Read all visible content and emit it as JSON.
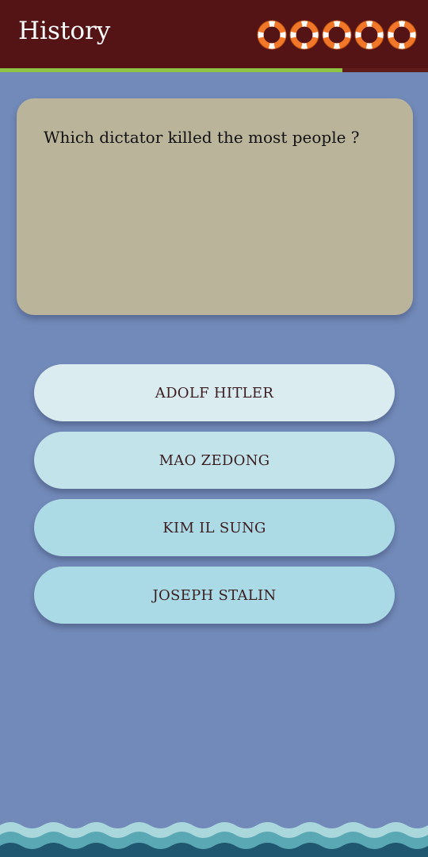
{
  "header": {
    "title": "History",
    "lives_count": 5,
    "progress": 0.8
  },
  "question": {
    "text": "Which dictator killed the most people ?"
  },
  "answers": [
    {
      "label": "ADOLF HITLER",
      "color": "#daecf0"
    },
    {
      "label": "MAO ZEDONG",
      "color": "#c3e3ea"
    },
    {
      "label": "KIM IL SUNG",
      "color": "#acdbe6"
    },
    {
      "label": "JOSEPH STALIN",
      "color": "#aadae5"
    }
  ],
  "colors": {
    "header_bg": "#541416",
    "background": "#728ab9",
    "question_card": "#bab49b",
    "progress_fill": "#8ec343",
    "buoy_orange": "#f07828",
    "buoy_white": "#ffffff"
  },
  "icons": {
    "life": "life-buoy-icon"
  }
}
